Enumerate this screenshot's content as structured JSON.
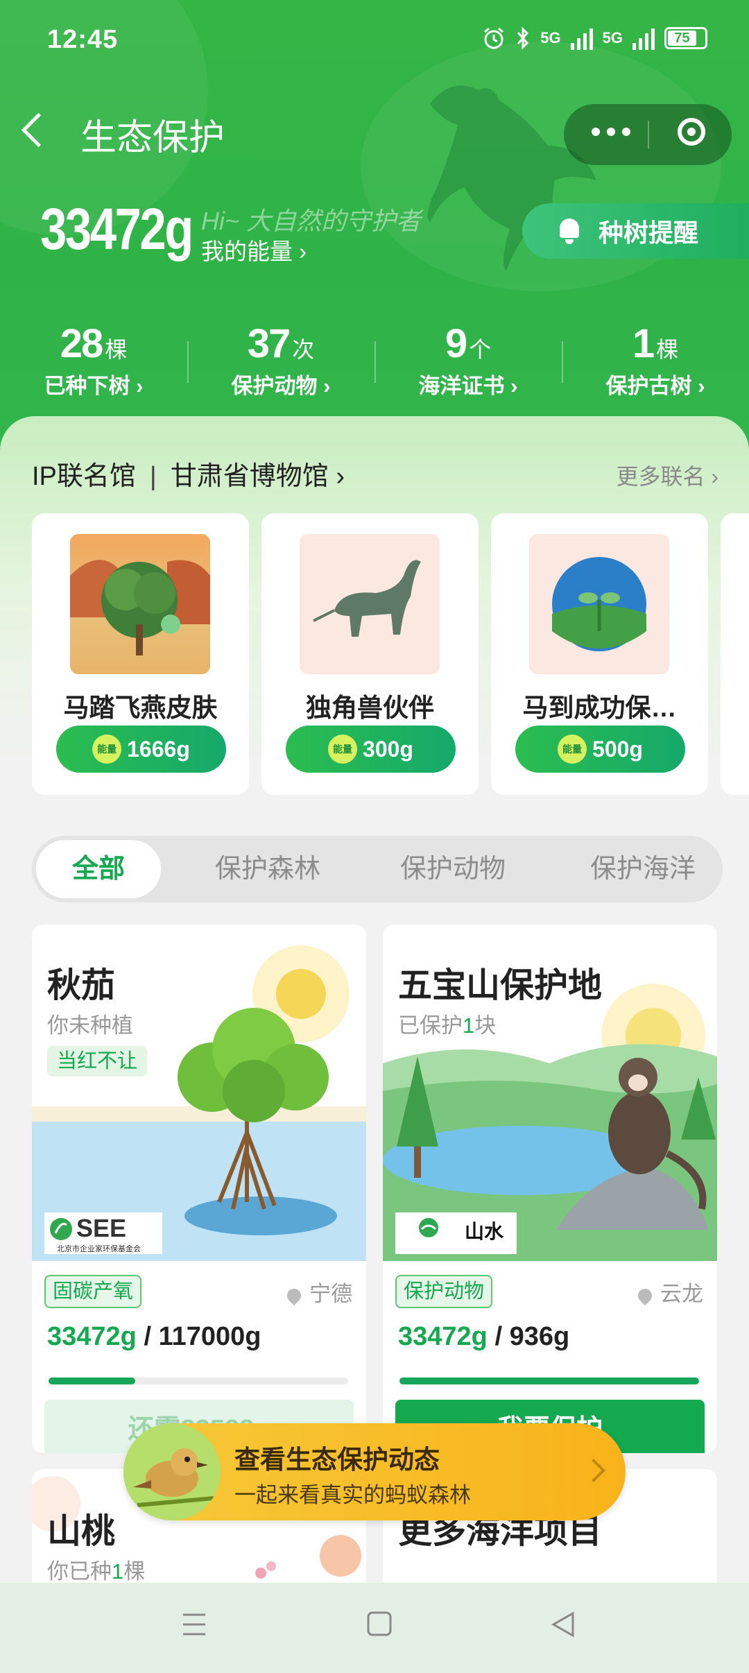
{
  "status_bar": {
    "time": "12:45",
    "battery": "75",
    "network1": "5G",
    "network2": "5G"
  },
  "nav": {
    "title": "生态保护"
  },
  "energy": {
    "value": "33472g",
    "greeting": "Hi~ 大自然的守护者",
    "label": "我的能量 ›",
    "remind_label": "种树提醒"
  },
  "stats": [
    {
      "num": "28",
      "unit": "棵",
      "label": "已种下树 ›"
    },
    {
      "num": "37",
      "unit": "次",
      "label": "保护动物 ›"
    },
    {
      "num": "9",
      "unit": "个",
      "label": "海洋证书 ›"
    },
    {
      "num": "1",
      "unit": "棵",
      "label": "保护古树 ›"
    }
  ],
  "ip": {
    "prefix": "IP联名馆",
    "divider": "|",
    "name": "甘肃省博物馆 ›",
    "more": "更多联名 ›",
    "energy_badge": "能量"
  },
  "ip_items": [
    {
      "name": "马踏飞燕皮肤",
      "price": "1666g"
    },
    {
      "name": "独角兽伙伴",
      "price": "300g"
    },
    {
      "name": "马到成功保…",
      "price": "500g"
    }
  ],
  "tabs": [
    "全部",
    "保护森林",
    "保护动物",
    "保护海洋"
  ],
  "projects": [
    {
      "title": "秋茄",
      "subtitle": "你未种植",
      "badge": "当红不让",
      "logo": "SEE",
      "logo_sub": "北京市企业家环保基金会",
      "tag": "固碳产氧",
      "location": "宁德",
      "current": "33472g",
      "sep": " / ",
      "target": "117000g",
      "progress": 0.29,
      "button": "还需83528g"
    },
    {
      "title": "五宝山保护地",
      "subtitle_pre": "已保护",
      "subtitle_num": "1",
      "subtitle_post": "块",
      "logo": "山水",
      "tag": "保护动物",
      "location": "云龙",
      "current": "33472g",
      "sep": " / ",
      "target": "936g",
      "progress": 1.0,
      "button": "我要保护"
    },
    {
      "title": "山桃",
      "subtitle_pre": "你已种",
      "subtitle_num": "1",
      "subtitle_post": "棵"
    },
    {
      "title": "更多海洋项目"
    }
  ],
  "floating_banner": {
    "title": "查看生态保护动态",
    "subtitle": "一起来看真实的蚂蚁森林"
  },
  "colors": {
    "brand_green": "#33b44a",
    "accent_green": "#14a84f",
    "banner_yellow": "#f6c93a"
  }
}
